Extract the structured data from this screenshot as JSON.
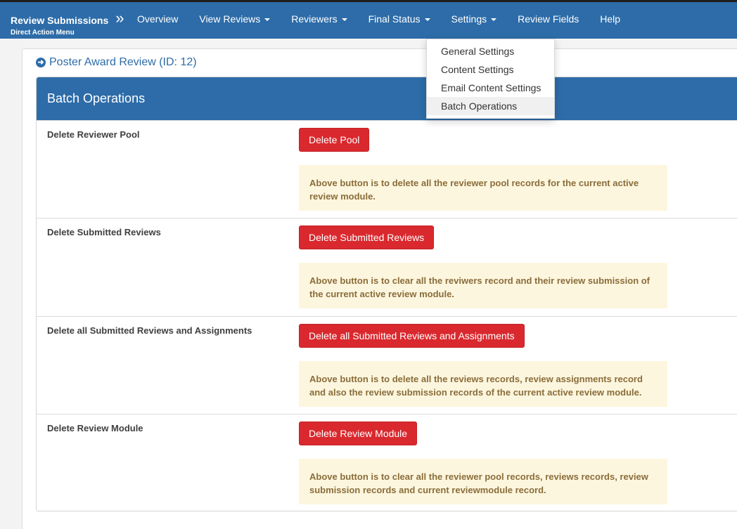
{
  "brand": {
    "title": "Review Submissions",
    "subtitle": "Direct Action Menu",
    "chevron": "»"
  },
  "nav": [
    {
      "label": "Overview"
    },
    {
      "label": "View Reviews"
    },
    {
      "label": "Reviewers"
    },
    {
      "label": "Final Status"
    },
    {
      "label": "Settings"
    },
    {
      "label": "Review Fields"
    },
    {
      "label": "Help"
    }
  ],
  "settings_menu": [
    {
      "label": "General Settings"
    },
    {
      "label": "Content Settings"
    },
    {
      "label": "Email Content Settings"
    },
    {
      "label": "Batch Operations"
    }
  ],
  "page": {
    "title": "Poster Award Review (ID: 12)",
    "title_icon": "circle-arrow-right-icon"
  },
  "panel": {
    "heading": "Batch Operations"
  },
  "operations": [
    {
      "label": "Delete Reviewer Pool",
      "button": "Delete Pool",
      "note": "Above button is to delete all the reviewer pool records for the current active review module."
    },
    {
      "label": "Delete Submitted Reviews",
      "button": "Delete Submitted Reviews",
      "note": "Above button is to clear all the reviwers record and their review submission of the current active review module."
    },
    {
      "label": "Delete all Submitted Reviews and Assignments",
      "button": "Delete all Submitted Reviews and Assignments",
      "note": "Above button is to delete all the reviews records, review assignments record and also the review submission records of the current active review module."
    },
    {
      "label": "Delete Review Module",
      "button": "Delete Review Module",
      "note": "Above button is to clear all the reviewer pool records, reviews records, review submission records and current reviewmodule record."
    }
  ],
  "colors": {
    "primary": "#2d6ca8",
    "danger": "#d9292e",
    "note_bg": "#fdf6de",
    "note_text": "#8a6d3b"
  }
}
